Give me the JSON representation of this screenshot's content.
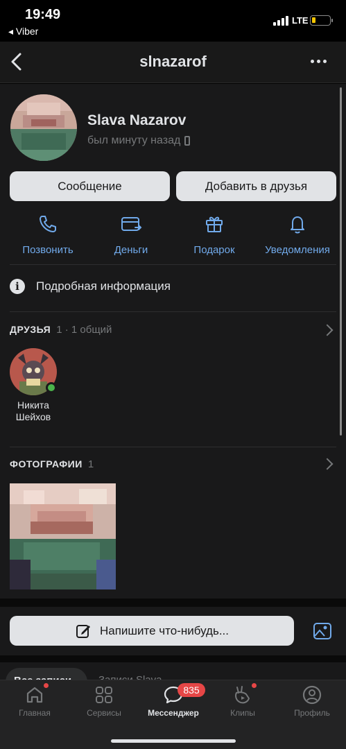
{
  "status_bar": {
    "time": "19:49",
    "back_app": "◂ Viber",
    "network": "LTE"
  },
  "header": {
    "title": "slnazarof"
  },
  "profile": {
    "name": "Slava Nazarov",
    "last_seen": "был минуту назад",
    "message_button": "Сообщение",
    "add_friend_button": "Добавить в друзья"
  },
  "actions": [
    {
      "label": "Позвонить",
      "icon": "phone-icon"
    },
    {
      "label": "Деньги",
      "icon": "money-card-icon"
    },
    {
      "label": "Подарок",
      "icon": "gift-icon"
    },
    {
      "label": "Уведомления",
      "icon": "bell-icon"
    }
  ],
  "details_row": {
    "label": "Подробная информация"
  },
  "friends": {
    "title": "ДРУЗЬЯ",
    "meta": "1 · 1 общий",
    "items": [
      {
        "name": "Никита Шейхов",
        "online": true
      }
    ]
  },
  "photos": {
    "title": "ФОТОГРАФИИ",
    "count": "1"
  },
  "composer": {
    "placeholder": "Напишите что-нибудь..."
  },
  "wall_tabs": {
    "active": "Все записи",
    "other": "Записи Slava"
  },
  "tabbar": {
    "items": [
      {
        "label": "Главная",
        "icon": "home-icon"
      },
      {
        "label": "Сервисы",
        "icon": "services-icon"
      },
      {
        "label": "Мессенджер",
        "icon": "messenger-icon",
        "active": true
      },
      {
        "label": "Клипы",
        "icon": "clips-icon"
      },
      {
        "label": "Профиль",
        "icon": "profile-icon"
      }
    ],
    "messenger_badge": "835"
  },
  "colors": {
    "background": "#19191a",
    "accent": "#71aaeb",
    "badge": "#e64646",
    "online": "#4bb34b",
    "battery": "#f5c500"
  }
}
